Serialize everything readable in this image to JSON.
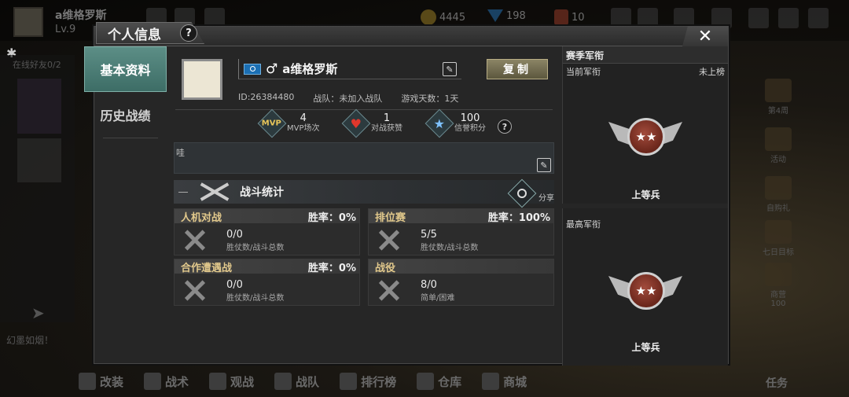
{
  "background": {
    "player_name": "a维格罗斯",
    "level": "Lv.9",
    "coins": "4445",
    "gems": "198",
    "medals": "10",
    "left_tabs": [
      "在线好友0/2"
    ],
    "chat_text": "幻墨如烟！",
    "right_items": [
      "第4周",
      "活动",
      "自购礼",
      "七日目标",
      "商营"
    ],
    "right_value": "100",
    "bottom_nav": [
      "改装",
      "战术",
      "观战",
      "战队",
      "排行榜",
      "仓库",
      "商城"
    ],
    "task_label": "任务"
  },
  "modal": {
    "title": "个人信息",
    "help": "?",
    "close": "✕"
  },
  "nav": {
    "items": [
      {
        "label": "基本资料",
        "active": true
      },
      {
        "label": "历史战绩",
        "active": false
      }
    ]
  },
  "profile": {
    "gender_symbol": "♂",
    "name": "a维格罗斯",
    "copy_label": "复制",
    "id_text": "ID:26384480",
    "team_text": "战队：未加入战队",
    "days_text": "游戏天数：1天"
  },
  "stats": {
    "mvp_icon_text": "MVP",
    "mvp_count": "4",
    "mvp_label": "MVP场次",
    "likes_count": "1",
    "likes_label": "对战获赞",
    "credit_count": "100",
    "credit_label": "信誉积分",
    "help": "?"
  },
  "signature": {
    "text": "哇"
  },
  "battle": {
    "title": "战斗统计",
    "share_label": "分享",
    "modes": [
      {
        "title": "人机对战",
        "rate": "胜率：0%",
        "value": "0/0",
        "sub": "胜仗数/战斗总数"
      },
      {
        "title": "排位赛",
        "rate": "胜率：100%",
        "value": "5/5",
        "sub": "胜仗数/战斗总数"
      },
      {
        "title": "合作遭遇战",
        "rate": "胜率：0%",
        "value": "0/0",
        "sub": "胜仗数/战斗总数"
      },
      {
        "title": "战役",
        "rate": "",
        "value": "8/0",
        "sub": "简单/困难"
      }
    ]
  },
  "rank": {
    "section_title": "赛季军衔",
    "current_label": "当前军衔",
    "current_status": "未上榜",
    "current_rank": "上等兵",
    "highest_label": "最高军衔",
    "highest_rank": "上等兵"
  }
}
